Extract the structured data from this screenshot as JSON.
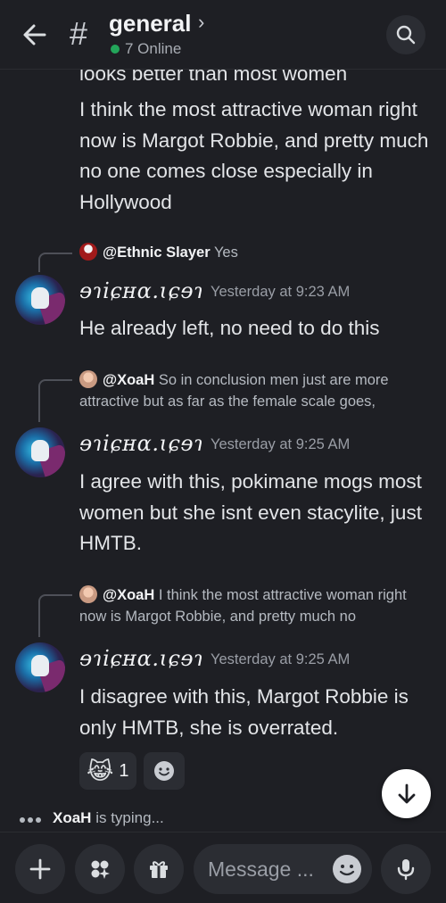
{
  "header": {
    "channel_name": "general",
    "chevron": "›",
    "online": "7 Online",
    "hash": "#"
  },
  "messages": [
    {
      "lines": [
        "looks better than most women",
        "I think the most attractive woman right now is Margot Robbie, and pretty much no one comes close especially in Hollywood"
      ]
    },
    {
      "reply_name": "@Ethnic Slayer",
      "reply_text": "Yes",
      "username": "ɘɿiɕʜɑ.ɩɕɘɿ",
      "time": "Yesterday at 9:23 AM",
      "body": "He already left, no need to do this"
    },
    {
      "reply_name": "@XoaH",
      "reply_text": "So in conclusion men just are more attractive but as far as the female scale goes,",
      "username": "ɘɿiɕʜɑ.ɩɕɘɿ",
      "time": "Yesterday at 9:25 AM",
      "body": "I agree with this, pokimane mogs most women but she isnt even stacylite, just HMTB."
    },
    {
      "reply_name": "@XoaH",
      "reply_text": "I think the most attractive woman right now is Margot Robbie, and pretty much no",
      "username": "ɘɿiɕʜɑ.ɩɕɘɿ",
      "time": "Yesterday at 9:25 AM",
      "body": "I disagree with this, Margot Robbie is only HMTB, she is overrated."
    }
  ],
  "reaction": {
    "emoji": "😹",
    "count": "1"
  },
  "typing": {
    "name": "XoaH",
    "text": "is typing..."
  },
  "composer": {
    "placeholder": "Message ..."
  },
  "icons": {
    "back": "back-arrow-icon",
    "search": "search-icon",
    "add": "plus-icon",
    "apps": "apps-icon",
    "gift": "gift-icon",
    "emoji": "emoji-icon",
    "mic": "microphone-icon",
    "jump": "arrow-down-icon"
  },
  "colors": {
    "online": "#23a55a",
    "background": "#1e1f24"
  }
}
